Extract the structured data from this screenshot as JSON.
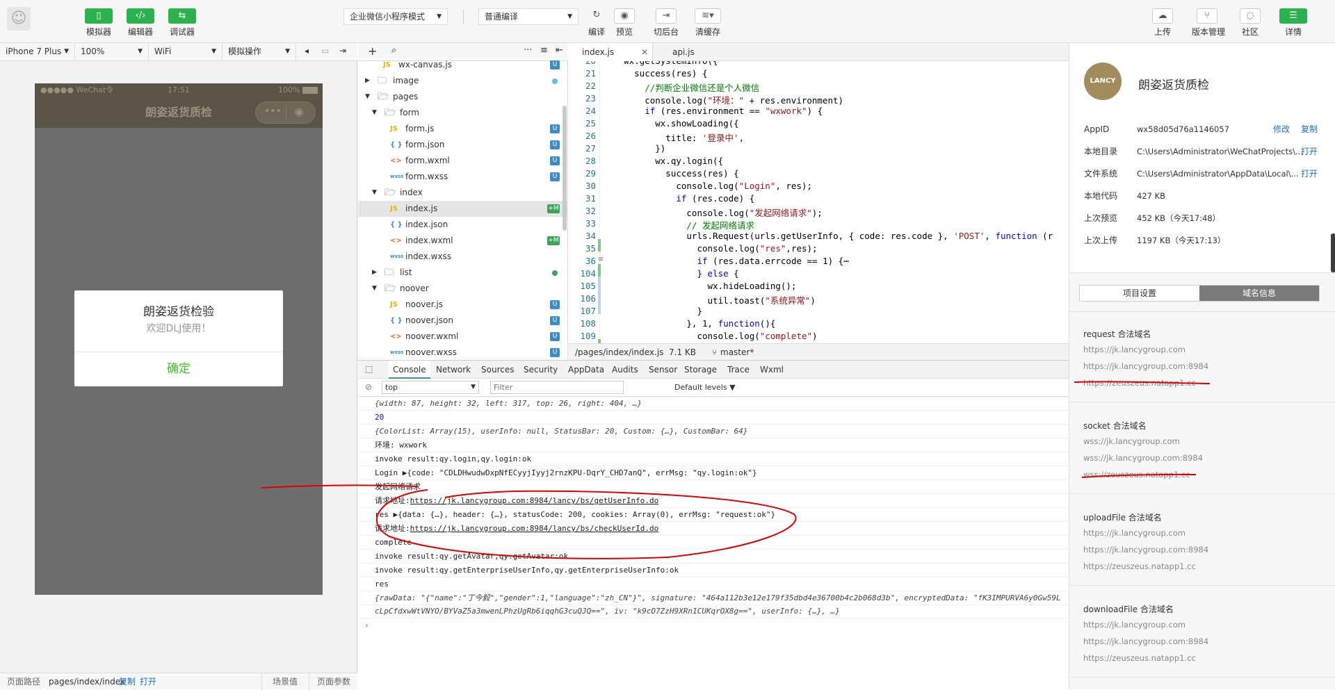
{
  "toolbar": {
    "simulator": "模拟器",
    "editor": "编辑器",
    "debugger": "调试器",
    "mode_select": "企业微信小程序模式",
    "compile_select": "普通编译",
    "compile": "编译",
    "preview": "预览",
    "background": "切后台",
    "clear_cache": "清缓存",
    "upload": "上传",
    "version": "版本管理",
    "community": "社区",
    "details": "详情"
  },
  "simbar": {
    "device": "iPhone 7 Plus",
    "zoom": "100%",
    "network": "WiFi",
    "simulate_op": "模拟操作"
  },
  "phone": {
    "status_left": "●●●●● WeChat令",
    "time": "17:51",
    "battery": "100%",
    "nav_title": "朗姿返货质检",
    "modal_title": "朗姿返货检验",
    "modal_content": "欢迎DLJ使用！",
    "modal_confirm": "确定"
  },
  "simfooter": {
    "path_label": "页面路径",
    "path": "pages/index/index",
    "copy": "复制",
    "open": "打开",
    "scene": "场景值",
    "params": "页面参数"
  },
  "tree": {
    "items": [
      {
        "name": "wx-canvas.js",
        "type": "js",
        "badge": "U"
      },
      {
        "name": "image",
        "type": "folder",
        "dot": "#5bc0eb"
      },
      {
        "name": "pages",
        "type": "folder-open"
      },
      {
        "name": "form",
        "type": "folder-open"
      },
      {
        "name": "form.js",
        "type": "js",
        "badge": "U"
      },
      {
        "name": "form.json",
        "type": "json",
        "badge": "U"
      },
      {
        "name": "form.wxml",
        "type": "wxml",
        "badge": "U"
      },
      {
        "name": "form.wxss",
        "type": "wxss",
        "badge": "U"
      },
      {
        "name": "index",
        "type": "folder-open"
      },
      {
        "name": "index.js",
        "type": "js",
        "badge": "+M"
      },
      {
        "name": "index.json",
        "type": "json"
      },
      {
        "name": "index.wxml",
        "type": "wxml",
        "badge": "+M"
      },
      {
        "name": "index.wxss",
        "type": "wxss"
      },
      {
        "name": "list",
        "type": "folder",
        "dot": "#3aa55a"
      },
      {
        "name": "noover",
        "type": "folder-open"
      },
      {
        "name": "noover.js",
        "type": "js",
        "badge": "U"
      },
      {
        "name": "noover.json",
        "type": "json",
        "badge": "U"
      },
      {
        "name": "noover.wxml",
        "type": "wxml",
        "badge": "U"
      },
      {
        "name": "noover.wxss",
        "type": "wxss",
        "badge": "U"
      }
    ]
  },
  "editor": {
    "tabs": [
      "index.js",
      "api.js"
    ],
    "status_path": "/pages/index/index.js",
    "status_size": "7.1 KB",
    "status_branch": "master*",
    "lines": [
      {
        "n": "20",
        "t": "    wx.getSystemInfo({"
      },
      {
        "n": "21",
        "t": "      success(res) {"
      },
      {
        "n": "22",
        "t": "        //判断企业微信还是个人微信"
      },
      {
        "n": "23",
        "t": "        console.log(\"环境：\" + res.environment)"
      },
      {
        "n": "24",
        "t": "        if (res.environment == \"wxwork\") {"
      },
      {
        "n": "25",
        "t": "          wx.showLoading({"
      },
      {
        "n": "26",
        "t": "            title: '登录中',"
      },
      {
        "n": "27",
        "t": "          })"
      },
      {
        "n": "28",
        "t": "          wx.qy.login({"
      },
      {
        "n": "29",
        "t": "            success(res) {"
      },
      {
        "n": "30",
        "t": "              console.log(\"Login\", res);"
      },
      {
        "n": "31",
        "t": "              if (res.code) {"
      },
      {
        "n": "32",
        "t": "                console.log(\"发起网络请求\");"
      },
      {
        "n": "33",
        "t": "                // 发起网络请求"
      },
      {
        "n": "34",
        "t": "                urls.Request(urls.getUserInfo, { code: res.code }, 'POST', function (r"
      },
      {
        "n": "35",
        "t": "                  console.log(\"res\",res);"
      },
      {
        "n": "36",
        "t": "                  if (res.data.errcode == 1) {⋯"
      },
      {
        "n": "104",
        "t": "                  } else {"
      },
      {
        "n": "105",
        "t": "                    wx.hideLoading();"
      },
      {
        "n": "106",
        "t": "                    util.toast(\"系统异常\")"
      },
      {
        "n": "107",
        "t": "                  }"
      },
      {
        "n": "108",
        "t": "                }, 1, function(){"
      },
      {
        "n": "109",
        "t": "                  console.log(\"complete\")"
      }
    ]
  },
  "devtools": {
    "tabs": [
      "Console",
      "Network",
      "Sources",
      "Security",
      "AppData",
      "Audits",
      "Sensor",
      "Storage",
      "Trace",
      "Wxml"
    ],
    "context": "top",
    "filter_placeholder": "Filter",
    "levels": "Default levels",
    "console": [
      "{width: 87, height: 32, left: 317, top: 26, right: 404, …}",
      "20",
      "{ColorList: Array(15), userInfo: null, StatusBar: 20, Custom: {…}, CustomBar: 64}",
      "环境: wxwork",
      "invoke result:qy.login,qy.login:ok",
      "Login ▶{code: \"CDLDHwudwDxpNfECyyjIyyj2rnzKPU-DqrY_CHD7anQ\", errMsg: \"qy.login:ok\"}",
      "发起网络请求",
      "请求地址:",
      "https://jk.lancygroup.com:8984/lancy/bs/getUserInfo.do",
      "res ▶{data: {…}, header: {…}, statusCode: 200, cookies: Array(0), errMsg: \"request:ok\"}",
      "请求地址:",
      "https://jk.lancygroup.com:8984/lancy/bs/checkUserId.do",
      "complete",
      "invoke result:qy.getAvatar,qy.getAvatar:ok",
      "invoke result:qy.getEnterpriseUserInfo,qy.getEnterpriseUserInfo:ok",
      "res",
      "{rawData: \"{\"name\":\"丁今毅\",\"gender\":1,\"language\":\"zh_CN\"}\", signature: \"464a112b3e12e179f35dbd4e36700b4c2b068d3b\", encryptedData: \"fK3IMPURVA6y0Gw59L",
      "cLpCfdxwWtVNYO/BYVaZ5a3mwenLPhzUgRb6iqqhG3cuQJQ==\", iv: \"k9cO7ZzH9XRn1CUKqrOX8g==\", userInfo: {…}, …}"
    ]
  },
  "rpanel": {
    "logo_text": "LANCY",
    "app_name": "朗姿返货质检",
    "fields": [
      {
        "k": "AppID",
        "v": "wx58d05d76a1146057",
        "a1": "修改",
        "a2": "复制"
      },
      {
        "k": "本地目录",
        "v": "C:\\Users\\Administrator\\WeChatProjects\\...",
        "a1": "打开"
      },
      {
        "k": "文件系统",
        "v": "C:\\Users\\Administrator\\AppData\\Local\\...",
        "a1": "打开"
      },
      {
        "k": "本地代码",
        "v": "427 KB"
      },
      {
        "k": "上次预览",
        "v": "452 KB（今天17:48）"
      },
      {
        "k": "上次上传",
        "v": "1197 KB（今天17:13）"
      }
    ],
    "tab_project": "项目设置",
    "tab_domain": "域名信息",
    "sections": [
      {
        "title": "request 合法域名",
        "items": [
          "https://jk.lancygroup.com",
          "https://jk.lancygroup.com:8984",
          "https://zeuszeus.natapp1.cc"
        ]
      },
      {
        "title": "socket 合法域名",
        "items": [
          "wss://jk.lancygroup.com",
          "wss://jk.lancygroup.com:8984",
          "wss://zeuszeus.natapp1.cc"
        ]
      },
      {
        "title": "uploadFile 合法域名",
        "items": [
          "https://jk.lancygroup.com",
          "https://jk.lancygroup.com:8984",
          "https://zeuszeus.natapp1.cc"
        ]
      },
      {
        "title": "downloadFile 合法域名",
        "items": [
          "https://jk.lancygroup.com",
          "https://jk.lancygroup.com:8984",
          "https://zeuszeus.natapp1.cc"
        ]
      }
    ]
  },
  "colors": {
    "brand_green": "#2bb24c",
    "annotation_red": "#e00000",
    "link_blue": "#1a73c9"
  }
}
